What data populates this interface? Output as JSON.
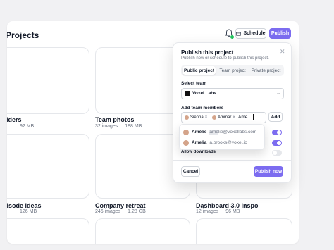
{
  "page": {
    "title": "Projects"
  },
  "header": {
    "schedule_label": "Schedule",
    "publish_label": "Publish"
  },
  "cards": [
    {
      "title": "Folders",
      "images": "",
      "size": "92 MB"
    },
    {
      "title": "Team photos",
      "images": "32 images",
      "size": "188 MB"
    },
    {
      "title": "Episode ideas",
      "images": "",
      "size": "126 MB"
    },
    {
      "title": "Company retreat",
      "images": "246 images",
      "size": "1.28 GB"
    },
    {
      "title": "Dashboard 3.0 inspo",
      "images": "12 images",
      "size": "96 MB"
    }
  ],
  "modal": {
    "title": "Publish this project",
    "subtitle": "Publish now or schedule to publish this project.",
    "tabs": [
      "Public project",
      "Team project",
      "Private project"
    ],
    "active_tab": 0,
    "select_team_label": "Select team",
    "team_value": "Voxel Labs",
    "members_label": "Add team members",
    "members": [
      "Sienna",
      "Ammar"
    ],
    "typed_value": "Ame",
    "add_label": "Add",
    "toggles": [
      true,
      true,
      false
    ],
    "allow_downloads_label": "Allow downloads",
    "cancel_label": "Cancel",
    "publish_now_label": "Publish now"
  },
  "dropdown": {
    "items": [
      {
        "name": "Amélie",
        "email_match": "ame",
        "email_rest": "lie@voxellabs.com"
      },
      {
        "name": "Amelia",
        "email_match": "",
        "email_rest": "a.brooks@voxel.io"
      }
    ]
  },
  "colors": {
    "accent": "#7c6cf0",
    "online": "#22c55e"
  }
}
